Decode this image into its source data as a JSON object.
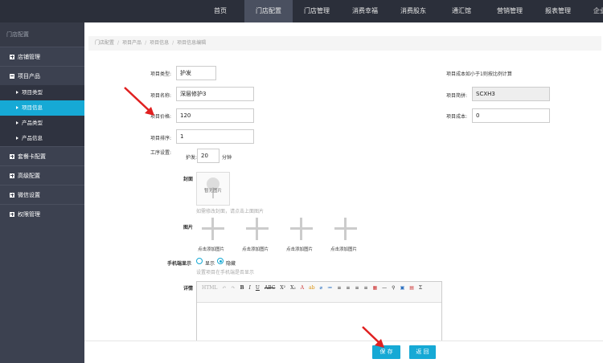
{
  "topnav": [
    "首页",
    "门店配置",
    "门店管理",
    "消费幸福",
    "消费股东",
    "通汇馆",
    "营销管理",
    "报表管理",
    "企业商城"
  ],
  "sidebar": {
    "header": "门店配置",
    "groups": [
      {
        "label": "店铺管理",
        "expanded": false
      },
      {
        "label": "项目产品",
        "expanded": true,
        "items": [
          "项目类型",
          "项目信息",
          "产品类型",
          "产品信息"
        ]
      },
      {
        "label": "套餐卡配置",
        "expanded": false
      },
      {
        "label": "高级配置",
        "expanded": false
      },
      {
        "label": "微信设置",
        "expanded": false
      },
      {
        "label": "权限管理",
        "expanded": false
      }
    ]
  },
  "breadcrumb": [
    "门店配置",
    "项目产品",
    "项目信息",
    "项目信息编辑"
  ],
  "form": {
    "type_label": "项目类型:",
    "type_value": "护发",
    "name_label": "项目名称:",
    "name_value": "深层修护3",
    "price_label": "项目价格:",
    "price_value": "120",
    "order_label": "项目排序:",
    "order_value": "1",
    "process_label": "工序设置:",
    "process_name": "护发:",
    "process_minutes": "20",
    "process_unit": "分钟",
    "cost_note": "项目成本如小于1则按比例计算",
    "code_label": "项目简拼:",
    "code_value": "SCXH3",
    "cost_label": "项目成本:",
    "cost_value": "0",
    "cover_label": "封面",
    "cover_placeholder": "暂无图片",
    "cover_hint": "如需修改封面，请点击上面图片",
    "images_label": "图片",
    "add_image_label": "点击添加图片",
    "mobile_label": "手机端显示",
    "mobile_show": "显示",
    "mobile_hide": "隐藏",
    "mobile_hint": "设置项目在手机端是否显示",
    "detail_label": "详情"
  },
  "editor_toolbar": [
    "HTML",
    "↶",
    "↷",
    "B",
    "I",
    "U",
    "ABC",
    "X²",
    "X₂",
    "A",
    "ab",
    "⌀",
    "≔",
    "≡",
    "≡",
    "≡",
    "≡",
    "▦",
    "—",
    "⚲",
    "▣",
    "▤",
    "Σ"
  ],
  "buttons": {
    "save": "保 存",
    "back": "返 回"
  },
  "colors": {
    "accent": "#16a9d5",
    "topbar": "#2b2f3a",
    "sidebar": "#3c4150"
  }
}
